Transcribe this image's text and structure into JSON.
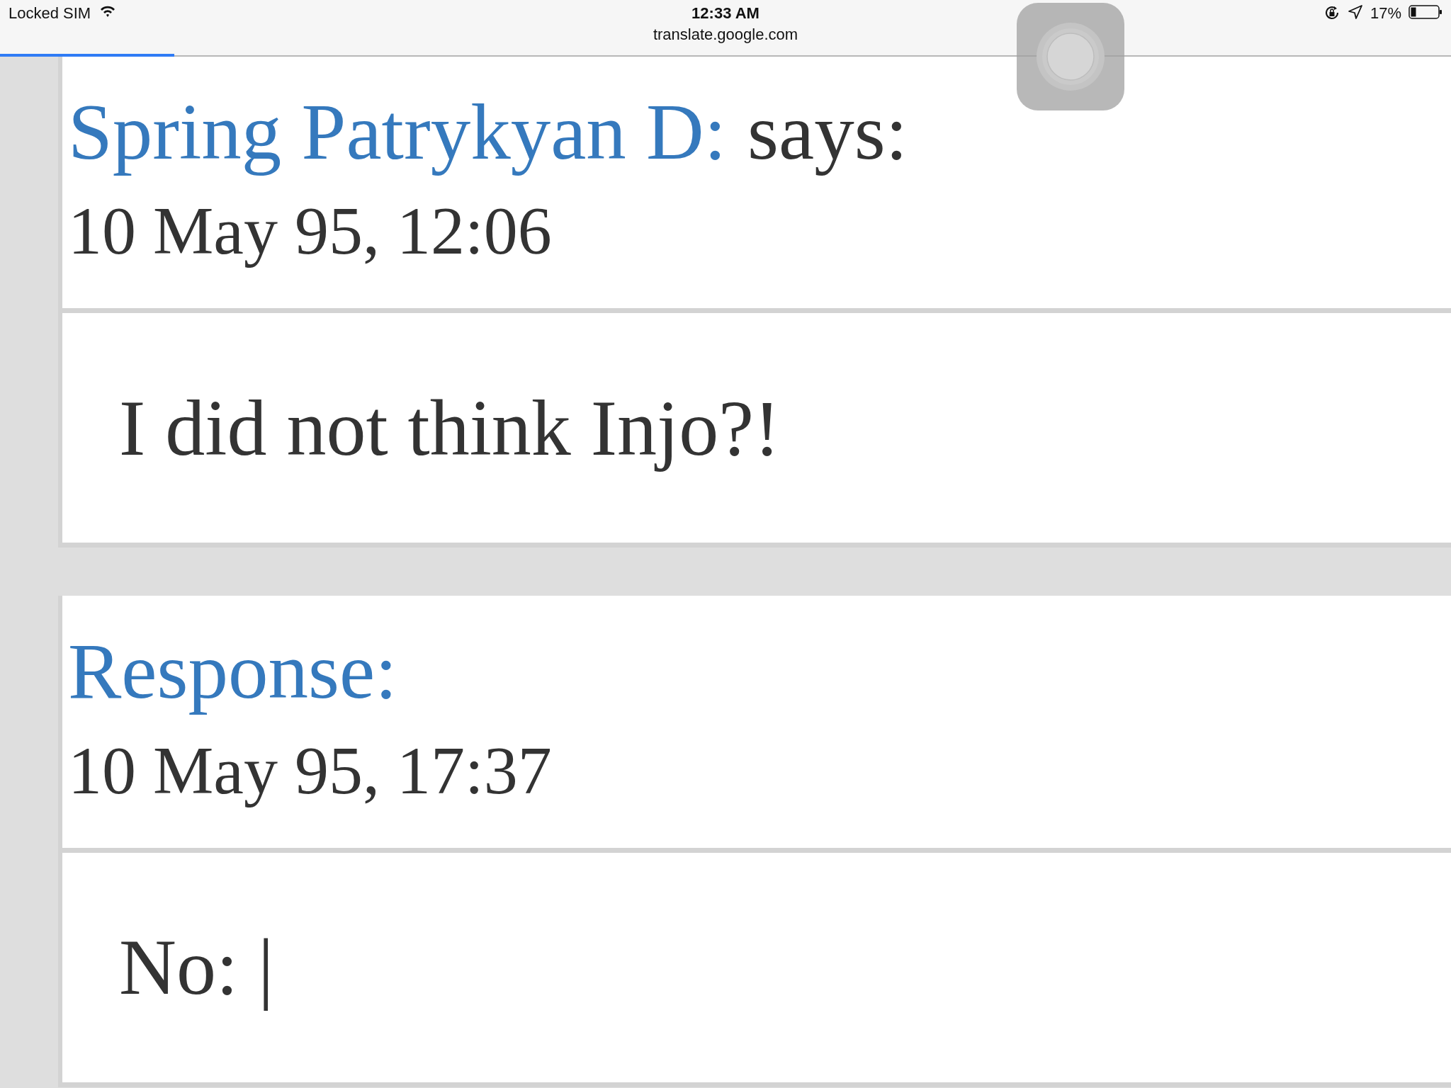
{
  "status_bar": {
    "carrier": "Locked SIM",
    "time": "12:33 AM",
    "url": "translate.google.com",
    "battery": "17%",
    "load_progress": {
      "level": 0.12
    }
  },
  "posts": [
    {
      "author": "Spring Patrykyan D:",
      "verb": "says:",
      "date": "10 May 95, 12:06",
      "message": "I did not think Injo?!"
    },
    {
      "author": "Response:",
      "date": "10 May 95, 17:37",
      "message": "No: |"
    }
  ]
}
